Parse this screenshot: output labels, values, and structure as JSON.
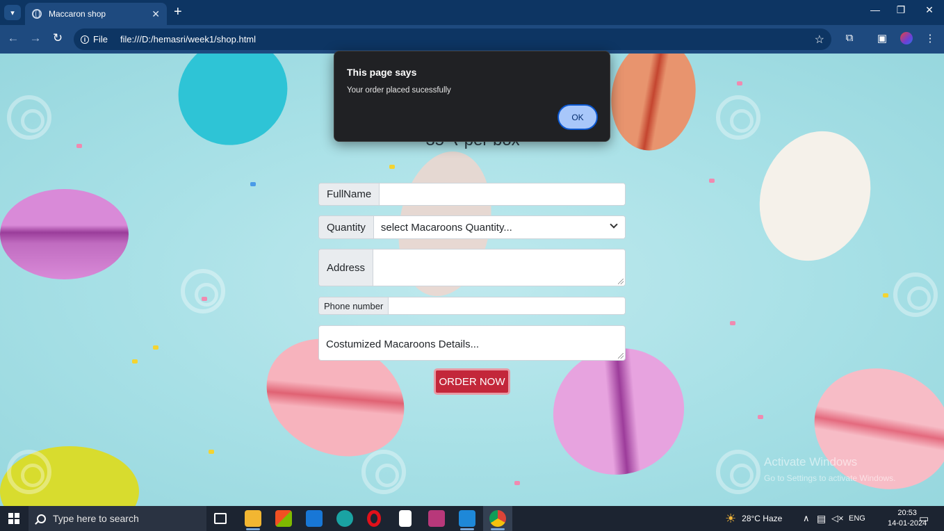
{
  "browser": {
    "tab_title": "Maccaron shop",
    "tab_close": "✕",
    "new_tab": "+",
    "site_info_label": "File",
    "url": "file:///D:/hemasri/week1/shop.html"
  },
  "page": {
    "heading_partial": "35 ₹ per box",
    "form": {
      "fullname_label": "FullName",
      "fullname_value": "",
      "quantity_label": "Quantity",
      "quantity_selected": "select Macaroons Quantity...",
      "address_label": "Address",
      "address_value": "",
      "phone_label": "Phone number",
      "phone_value": "",
      "custom_placeholder": "Costumized Macaroons Details...",
      "order_button": "ORDER NOW"
    },
    "watermark_line1": "Activate Windows",
    "watermark_line2": "Go to Settings to activate Windows."
  },
  "alert": {
    "title": "This page says",
    "message": "Your order placed sucessfully",
    "ok_label": "OK"
  },
  "taskbar": {
    "search_placeholder": "Type here to search",
    "weather": "28°C  Haze",
    "language": "ENG",
    "time": "20:53",
    "date": "14-01-2024"
  },
  "colors": {
    "order_button": "#c3273a",
    "dialog_bg": "#202124",
    "ok_button": "#a8c7fa",
    "browser_chrome": "#1e4a7f"
  }
}
